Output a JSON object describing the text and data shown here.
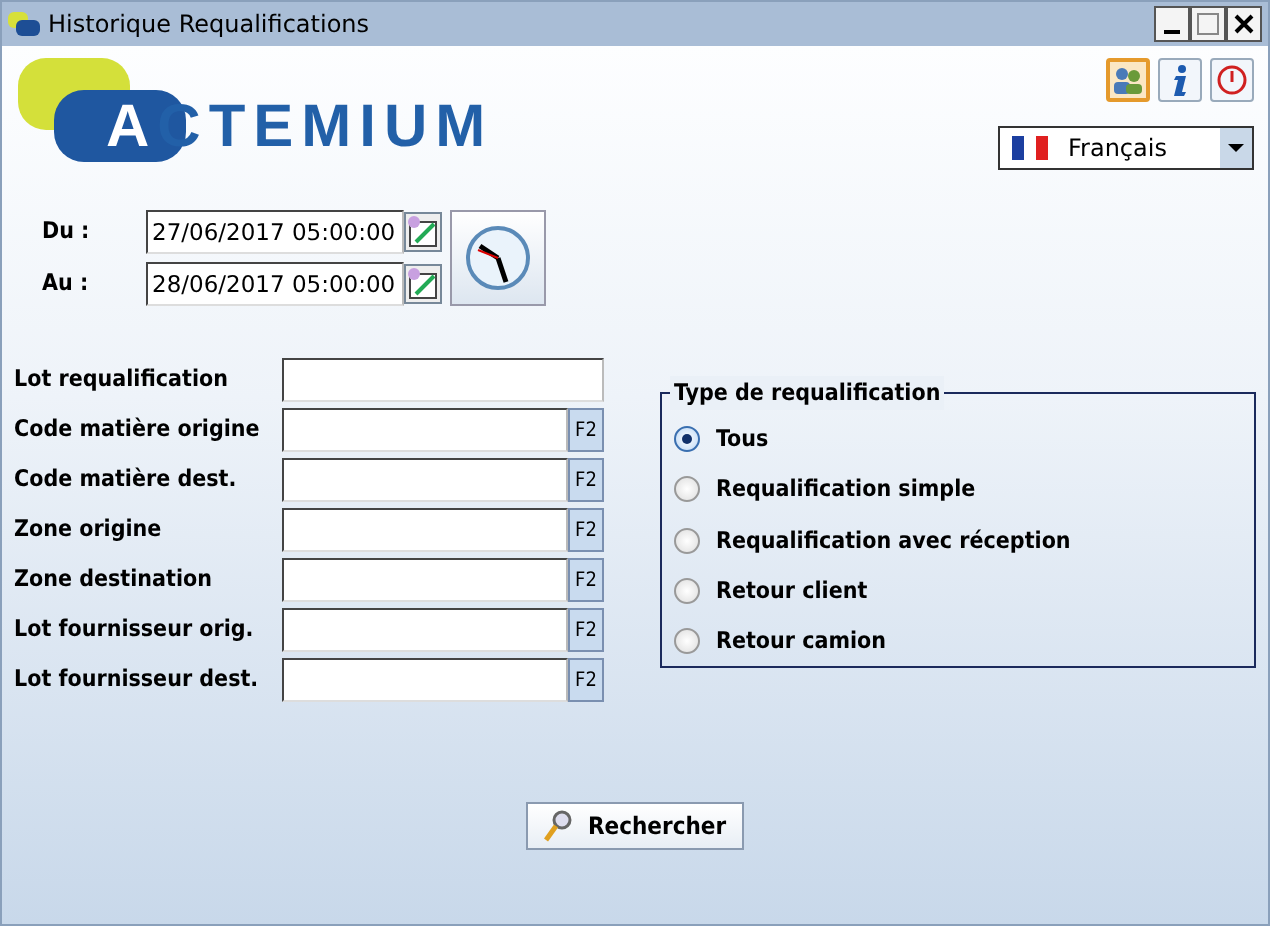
{
  "window": {
    "title": "Historique Requalifications"
  },
  "logo": {
    "text": "ACTEMIUM"
  },
  "toolbar": [
    {
      "kind": "users",
      "active": true
    },
    {
      "kind": "info",
      "active": false
    },
    {
      "kind": "power",
      "active": false
    }
  ],
  "language": {
    "value": "Français"
  },
  "dates": [
    {
      "label": "Du :",
      "value": "27/06/2017 05:00:00"
    },
    {
      "label": "Au :",
      "value": "28/06/2017 05:00:00"
    }
  ],
  "fields": [
    {
      "kind": "plain",
      "label": "Lot requalification"
    },
    {
      "kind": "lookup",
      "label": "Code matière origine",
      "button": "F2"
    },
    {
      "kind": "lookup",
      "label": "Code matière dest.",
      "button": "F2"
    },
    {
      "kind": "lookup",
      "label": "Zone origine",
      "button": "F2"
    },
    {
      "kind": "lookup",
      "label": "Zone destination",
      "button": "F2"
    },
    {
      "kind": "lookup",
      "label": "Lot fournisseur orig.",
      "button": "F2"
    },
    {
      "kind": "lookup",
      "label": "Lot fournisseur dest.",
      "button": "F2"
    }
  ],
  "requalification_type": {
    "title": "Type de requalification",
    "options": [
      {
        "label": "Tous",
        "selected": true
      },
      {
        "label": "Requalification simple",
        "selected": false
      },
      {
        "label": "Requalification avec réception",
        "selected": false
      },
      {
        "label": "Retour client",
        "selected": false
      },
      {
        "label": "Retour camion",
        "selected": false
      }
    ]
  },
  "search_button": {
    "label": "Rechercher"
  }
}
